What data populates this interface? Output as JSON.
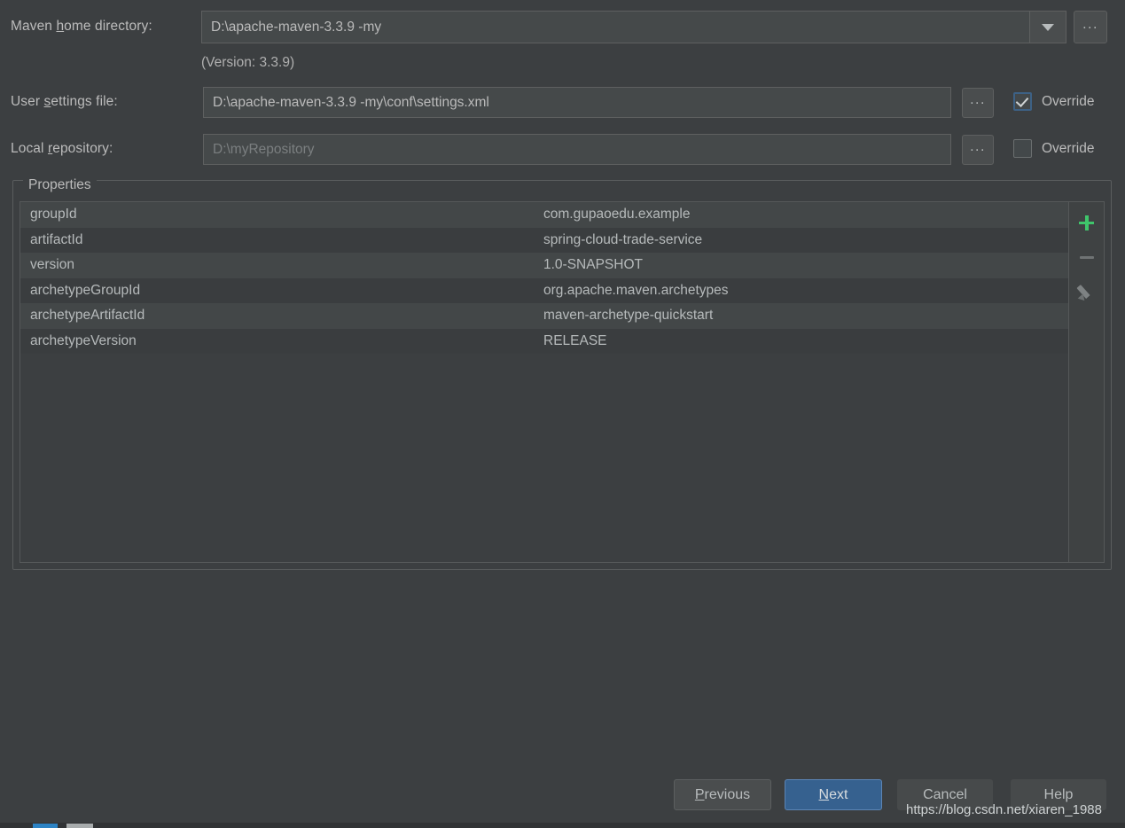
{
  "form": {
    "maven_home": {
      "label_before": "Maven ",
      "label_mnemonic": "h",
      "label_after": "ome directory:",
      "value": "D:\\apache-maven-3.3.9 -my",
      "dropdown_icon": "chevron-down-icon",
      "browse_label": "..."
    },
    "version_note": "(Version: 3.3.9)",
    "user_settings": {
      "label_before": "User ",
      "label_mnemonic": "s",
      "label_after": "ettings file:",
      "value": "D:\\apache-maven-3.3.9 -my\\conf\\settings.xml",
      "browse_label": "...",
      "override_label": "Override",
      "override_checked": true
    },
    "local_repository": {
      "label_before": "Local ",
      "label_mnemonic": "r",
      "label_after": "epository:",
      "value": "D:\\myRepository",
      "browse_label": "...",
      "override_label": "Override",
      "override_checked": false
    }
  },
  "properties_group": {
    "title": "Properties",
    "rows": [
      {
        "key": "groupId",
        "value": "com.gupaoedu.example"
      },
      {
        "key": "artifactId",
        "value": "spring-cloud-trade-service"
      },
      {
        "key": "version",
        "value": "1.0-SNAPSHOT"
      },
      {
        "key": "archetypeGroupId",
        "value": "org.apache.maven.archetypes"
      },
      {
        "key": "archetypeArtifactId",
        "value": "maven-archetype-quickstart"
      },
      {
        "key": "archetypeVersion",
        "value": "RELEASE"
      }
    ],
    "toolbar": {
      "add_icon": "plus-icon",
      "remove_icon": "minus-icon",
      "edit_icon": "pencil-icon"
    }
  },
  "footer": {
    "previous": {
      "before": "",
      "mnemonic": "P",
      "after": "revious"
    },
    "next": {
      "before": "",
      "mnemonic": "N",
      "after": "ext"
    },
    "cancel": "Cancel",
    "help": "Help"
  },
  "watermark": "https://blog.csdn.net/xiaren_1988",
  "colors": {
    "dialog_bg": "#3c3f41",
    "field_bg": "#45494a",
    "accent_blue": "#36618f",
    "checkbox_border": "#3d6185",
    "plus_green": "#3fc56b",
    "text": "#bbbbbb",
    "row_odd": "#434748",
    "row_even": "#3a3d3f"
  }
}
